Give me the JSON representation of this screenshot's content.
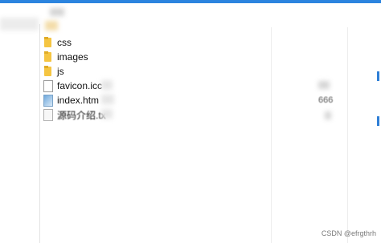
{
  "window": {
    "accent": "#2b84df"
  },
  "files": [
    {
      "name": "css",
      "icon": "folder-icon",
      "kind": "folder"
    },
    {
      "name": "images",
      "icon": "folder-icon",
      "kind": "folder"
    },
    {
      "name": "js",
      "icon": "folder-icon",
      "kind": "folder"
    },
    {
      "name": "favicon.icc",
      "icon": "file-icon",
      "kind": "file"
    },
    {
      "name": "index.htm",
      "icon": "html-icon",
      "kind": "file",
      "meta": "666"
    },
    {
      "name": "源码介绍.tx",
      "icon": "text-file-icon",
      "kind": "file"
    }
  ],
  "watermark": "CSDN @efrgthrh"
}
